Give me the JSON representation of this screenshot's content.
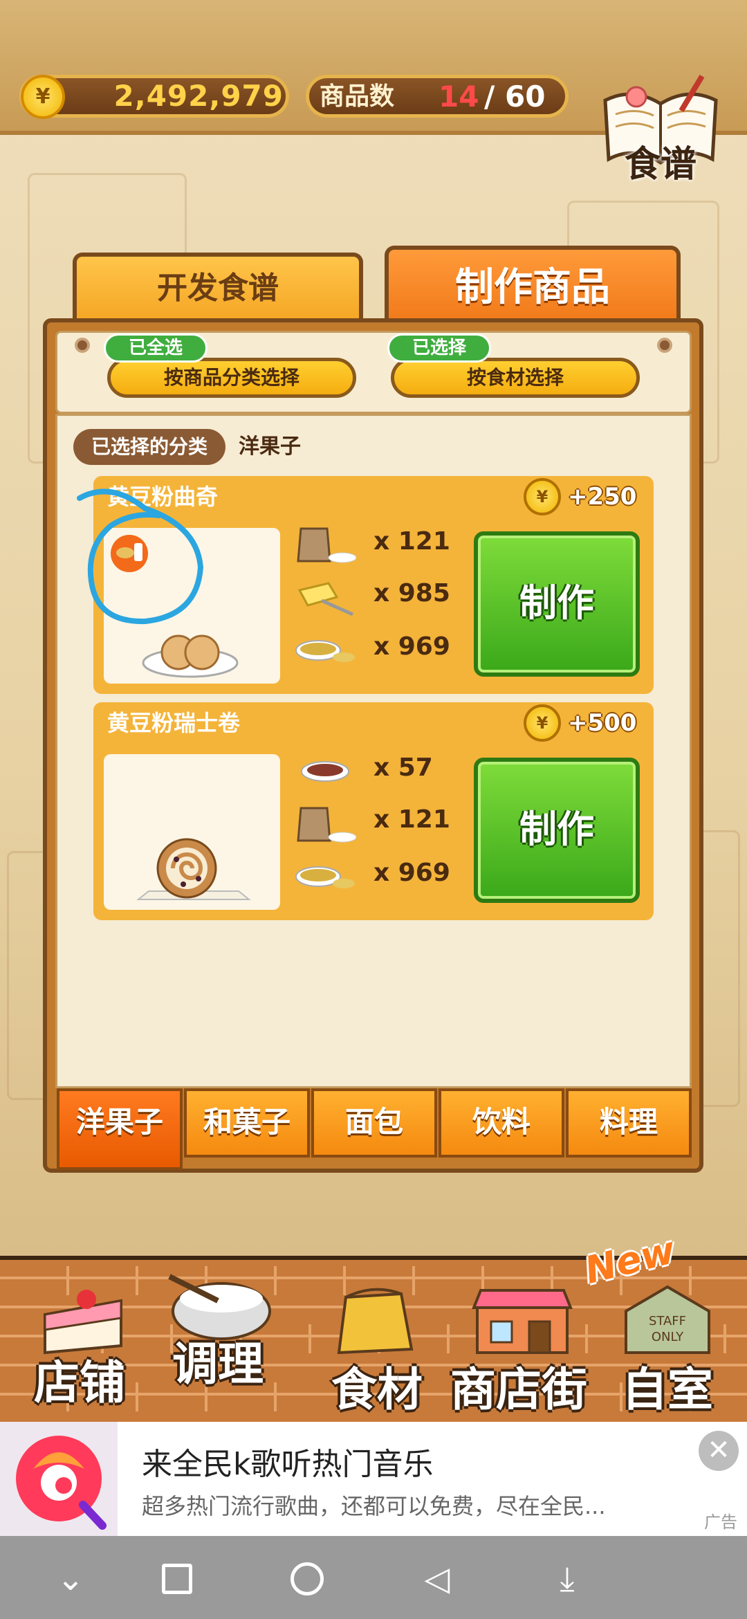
{
  "top_bar": {
    "coin_symbol": "¥",
    "money": "2,492,979",
    "goods_label": "商品数",
    "goods_current": "14",
    "goods_separator": "/",
    "goods_max": "60",
    "recipe_label": "食谱"
  },
  "tabs": {
    "develop": "开发食谱",
    "make": "制作商品",
    "active": "make"
  },
  "filters": [
    {
      "badge": "已全选",
      "label": "按商品分类选择"
    },
    {
      "badge": "已选择",
      "label": "按食材选择"
    }
  ],
  "selected_category": {
    "label": "已选择的分类",
    "value": "洋果子"
  },
  "products": [
    {
      "name": "黄豆粉曲奇",
      "reward": "+250",
      "make_label": "制作",
      "ingredients": [
        {
          "icon": "flour-bag-icon",
          "qty": "x 121"
        },
        {
          "icon": "butter-icon",
          "qty": "x 985"
        },
        {
          "icon": "soybean-powder-icon",
          "qty": "x 969"
        }
      ]
    },
    {
      "name": "黄豆粉瑞士卷",
      "reward": "+500",
      "make_label": "制作",
      "ingredients": [
        {
          "icon": "red-bean-icon",
          "qty": "x 57"
        },
        {
          "icon": "flour-bag-icon",
          "qty": "x 121"
        },
        {
          "icon": "soybean-powder-icon",
          "qty": "x 969"
        }
      ]
    }
  ],
  "category_tabs": [
    "洋果子",
    "和菓子",
    "面包",
    "饮料",
    "料理"
  ],
  "active_category_tab": 0,
  "bottom_nav": [
    "店铺",
    "调理",
    "食材",
    "商店街",
    "自室"
  ],
  "new_badge": "New",
  "ad": {
    "title": "来全民k歌听热门音乐",
    "description": "超多热门流行歌曲，还都可以免费，尽在全民...",
    "close": "✕",
    "tag": "广告"
  },
  "colors": {
    "accent_orange": "#f07818",
    "make_button_green": "#3aa81a",
    "badge_green": "#3fae3f",
    "annotation_blue": "#2ba6e0"
  }
}
